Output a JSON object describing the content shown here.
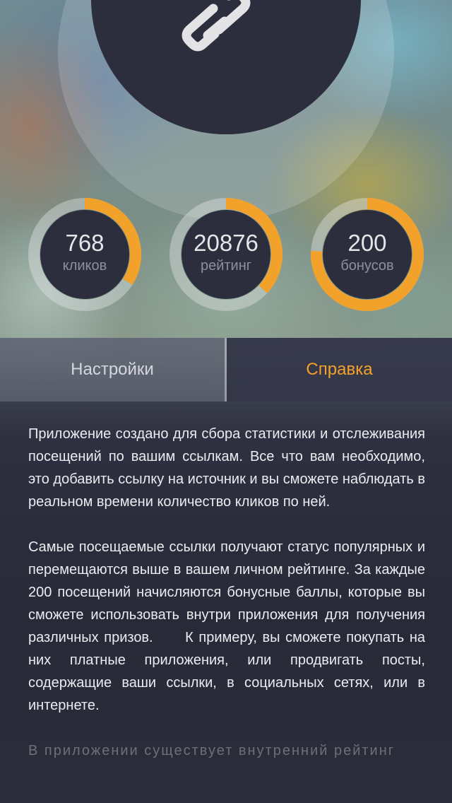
{
  "accent_color": "#f2a12a",
  "logo": {
    "icon": "chain-link-icon"
  },
  "stats": [
    {
      "value": "768",
      "label": "кликов",
      "progress": 0.34
    },
    {
      "value": "20876",
      "label": "рейтинг",
      "progress": 0.37
    },
    {
      "value": "200",
      "label": "бонусов",
      "progress": 0.76
    }
  ],
  "tabs": {
    "settings": "Настройки",
    "help": "Справка",
    "active": "help"
  },
  "content": {
    "paragraph_1": "Приложение создано для сбора статистики и отслеживания посещений по вашим ссылкам. Все что вам необходимо, это добавить ссылку на источник и вы сможете наблюдать в реальном времени количество кликов по ней.",
    "paragraph_2": "Самые посещаемые ссылки получают статус популярных и перемещаются выше в вашем личном рейтинге. За каждые 200 посещений начисляются бонусные баллы, которые вы сможете использовать внутри приложения для получения различных призов.      К примеру, вы сможете покупать на них платные приложения, или продвигать посты, содержащие ваши ссылки, в социальных сетях, или в интернете.",
    "paragraph_3": "В приложении существует внутренний рейтинг"
  }
}
